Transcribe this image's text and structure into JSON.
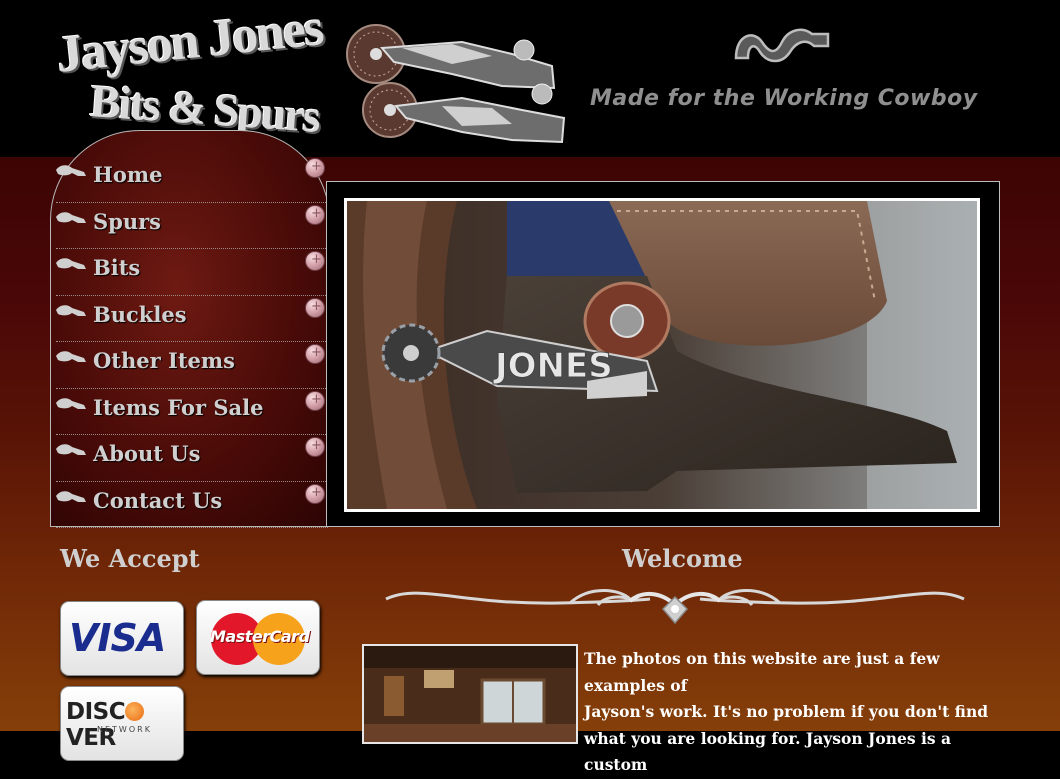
{
  "header": {
    "logo_line1": "Jayson Jones",
    "logo_line2": "Bits & Spurs",
    "tagline": "Made for the Working Cowboy"
  },
  "nav": {
    "items": [
      {
        "label": "Home"
      },
      {
        "label": "Spurs"
      },
      {
        "label": "Bits"
      },
      {
        "label": "Buckles"
      },
      {
        "label": "Other Items"
      },
      {
        "label": "Items For Sale"
      },
      {
        "label": "About Us"
      },
      {
        "label": "Contact Us"
      }
    ]
  },
  "hero": {
    "spur_stamp": "JONES"
  },
  "payment": {
    "title": "We Accept",
    "cards": {
      "visa": "VISA",
      "mastercard": "MasterCard",
      "discover_pre": "DISC",
      "discover_post": "VER",
      "discover_sub": "NETWORK"
    }
  },
  "welcome": {
    "title": "Welcome",
    "lines": [
      "The photos on this website are just a few examples of",
      "Jayson's work. It's no problem if you don't find",
      "what you are looking for. Jayson Jones is a custom"
    ]
  },
  "colors": {
    "header_bg": "#000000",
    "body_top": "#3d0404",
    "body_bottom": "#853f09",
    "nav_text": "#cfcfcf",
    "tagline": "#8f8f8f",
    "knob": "#d7a4ad"
  },
  "icons": {
    "nav_bullet": "horse-head-icon",
    "nav_end": "concho-knob-icon",
    "brand": "brand-mark-icon"
  }
}
